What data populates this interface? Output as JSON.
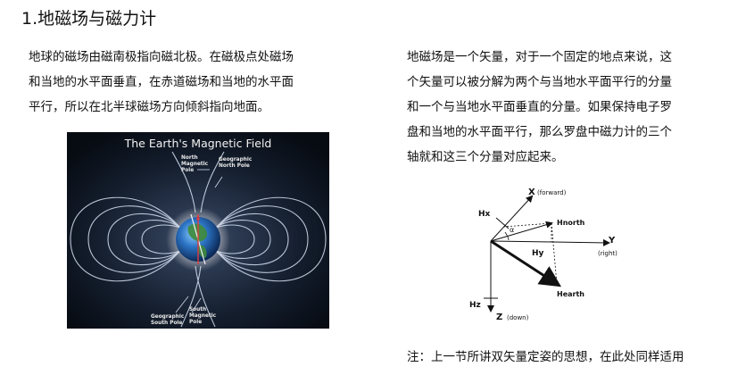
{
  "section": {
    "title": "1.地磁场与磁力计"
  },
  "left_paragraph": [
    "地球的磁场由磁南极指向磁北极。在磁极点处磁场",
    "和当地的水平面垂直，在赤道磁场和当地的水平面",
    "平行，所以在北半球磁场方向倾斜指向地面。"
  ],
  "right_paragraph": [
    "地磁场是一个矢量，对于一个固定的地点来说，这",
    "个矢量可以被分解为两个与当地水平面平行的分量",
    "和一个与当地水平面垂直的分量。如果保持电子罗",
    "盘和当地的水平面平行，那么罗盘中磁力计的三个",
    "轴就和这三个分量对应起来。"
  ],
  "earth_figure": {
    "title": "The Earth's Magnetic Field",
    "north_magnetic_pole": [
      "North",
      "Magnetic",
      "Pole"
    ],
    "geographic_north_pole": [
      "Geographic",
      "North Pole"
    ],
    "geographic_south_pole": [
      "Geographic",
      "South Pole"
    ],
    "south_magnetic_pole": [
      "South",
      "Magnetic",
      "Pole"
    ]
  },
  "axes_figure": {
    "x_axis": "X",
    "x_axis_note": "(forward)",
    "y_axis": "Y",
    "y_axis_note": "(right)",
    "z_axis": "Z",
    "z_axis_note": "(down)",
    "hx": "Hx",
    "hy": "Hy",
    "hz": "Hz",
    "hnorth": "Hnorth",
    "hearth": "Hearth",
    "alpha": "α"
  },
  "note": "注：上一节所讲双矢量定姿的思想，在此处同样适用"
}
